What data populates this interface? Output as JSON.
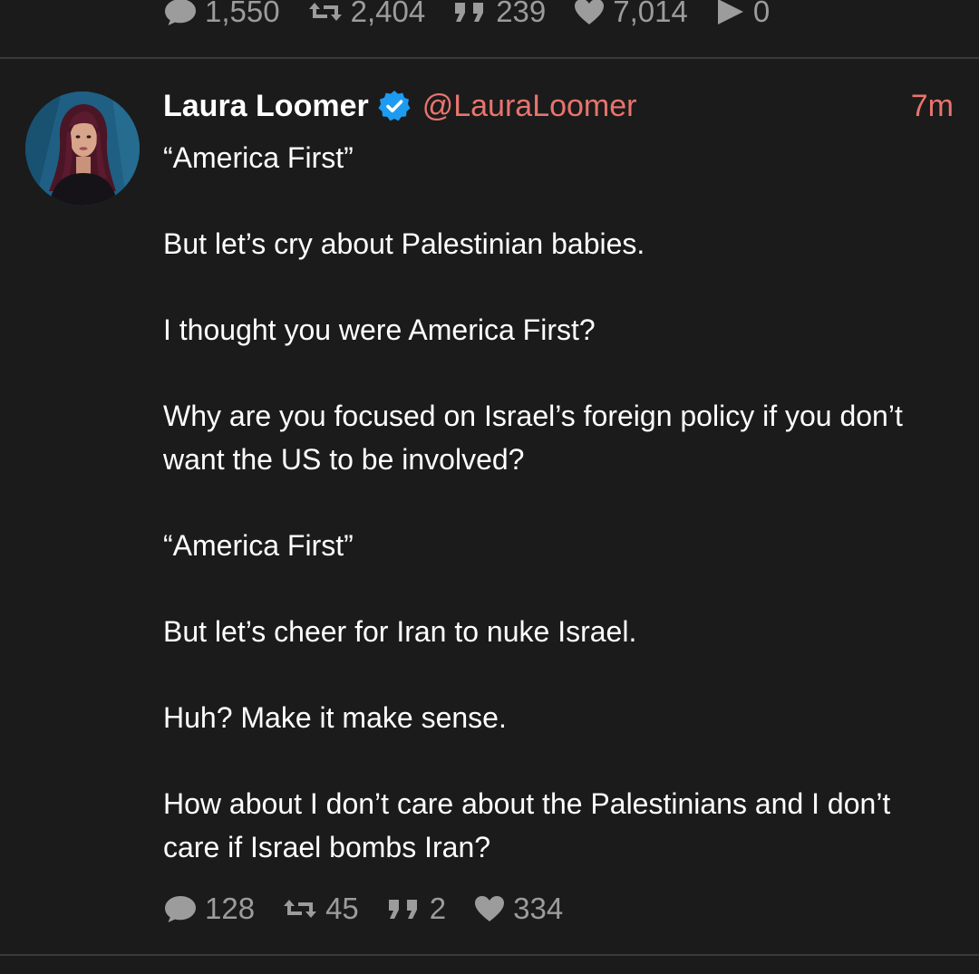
{
  "previous_post": {
    "stats": {
      "replies": "1,550",
      "retweets": "2,404",
      "quotes": "239",
      "likes": "7,014",
      "views": "0"
    }
  },
  "post": {
    "author_name": "Laura Loomer",
    "verified": true,
    "handle": "@LauraLoomer",
    "timestamp": "7m",
    "paragraphs": [
      "“America First”",
      "But let’s cry about Palestinian babies.",
      "I thought you were America First?",
      "Why are you focused on Israel’s foreign policy if you don’t want the US to be involved?",
      "“America First”",
      "But let’s cheer for Iran to nuke Israel.",
      "Huh? Make it make sense.",
      "How about I don’t care about the Palestinians and I don’t care if Israel bombs Iran?"
    ],
    "stats": {
      "replies": "128",
      "retweets": "45",
      "quotes": "2",
      "likes": "334"
    }
  },
  "icons": {
    "reply": "speech-bubble-icon",
    "retweet": "retweet-icon",
    "quote": "quote-icon",
    "like": "heart-icon",
    "views": "play-icon",
    "verified": "verified-badge-icon"
  },
  "colors": {
    "background": "#1b1b1b",
    "text": "#ffffff",
    "muted": "#9c9c9c",
    "accent": "#e8746e",
    "verified": "#1d9bf0",
    "divider": "#3a3a3a"
  }
}
